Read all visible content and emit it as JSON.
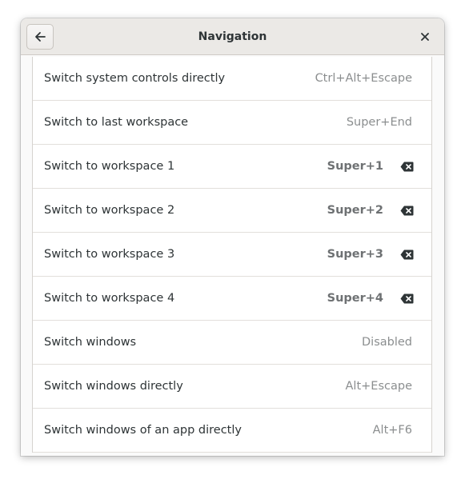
{
  "window": {
    "title": "Navigation",
    "back_icon": "arrow-left-icon",
    "close_icon": "close-icon"
  },
  "shortcuts": [
    {
      "label": "Switch system controls directly",
      "accel": "Ctrl+Alt+Escape",
      "custom": false
    },
    {
      "label": "Switch to last workspace",
      "accel": "Super+End",
      "custom": false
    },
    {
      "label": "Switch to workspace 1",
      "accel": "Super+1",
      "custom": true
    },
    {
      "label": "Switch to workspace 2",
      "accel": "Super+2",
      "custom": true
    },
    {
      "label": "Switch to workspace 3",
      "accel": "Super+3",
      "custom": true
    },
    {
      "label": "Switch to workspace 4",
      "accel": "Super+4",
      "custom": true
    },
    {
      "label": "Switch windows",
      "accel": "Disabled",
      "custom": false
    },
    {
      "label": "Switch windows directly",
      "accel": "Alt+Escape",
      "custom": false
    },
    {
      "label": "Switch windows of an app directly",
      "accel": "Alt+F6",
      "custom": false
    }
  ],
  "colors": {
    "headerbar": "#ebe9e6",
    "text": "#2e3436",
    "dim_text": "#8b8e8f"
  }
}
